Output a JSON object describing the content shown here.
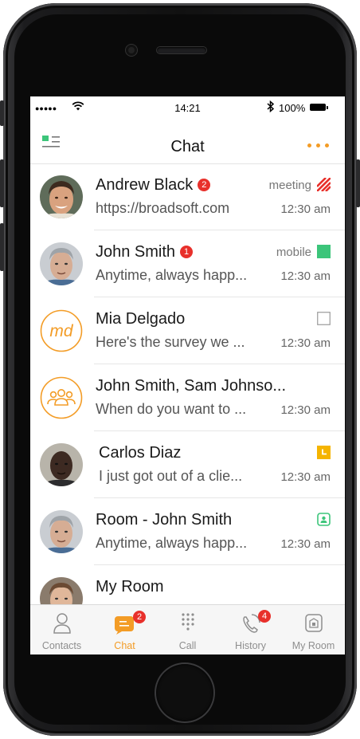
{
  "status_bar": {
    "signal": "●●●●●",
    "time": "14:21",
    "battery": "100%"
  },
  "header": {
    "title": "Chat"
  },
  "conversations": [
    {
      "name": "Andrew Black",
      "badge": "2",
      "preview": "https://broadsoft.com",
      "presence": "meeting",
      "time": "12:30 am"
    },
    {
      "name": "John Smith",
      "badge": "1",
      "preview": "Anytime, always happ...",
      "presence": "mobile",
      "time": "12:30 am"
    },
    {
      "name": "Mia Delgado",
      "initials": "md",
      "preview": "Here's the survey we ...",
      "time": "12:30 am"
    },
    {
      "name": "John Smith, Sam Johnso...",
      "preview": "When do you want to ...",
      "time": "12:30 am"
    },
    {
      "name": "Carlos Diaz",
      "preview": "I just got out of a clie...",
      "time": "12:30 am"
    },
    {
      "name": "Room - John Smith",
      "preview": "Anytime, always happ...",
      "time": "12:30 am"
    },
    {
      "name": "My Room"
    }
  ],
  "tabs": [
    {
      "label": "Contacts"
    },
    {
      "label": "Chat",
      "badge": "2"
    },
    {
      "label": "Call"
    },
    {
      "label": "History",
      "badge": "4"
    },
    {
      "label": "My Room"
    }
  ],
  "colors": {
    "accent": "#f39c26",
    "badge": "#e8302b",
    "available": "#3cc57a",
    "meeting": "#e8302b",
    "away": "#f5b400"
  }
}
